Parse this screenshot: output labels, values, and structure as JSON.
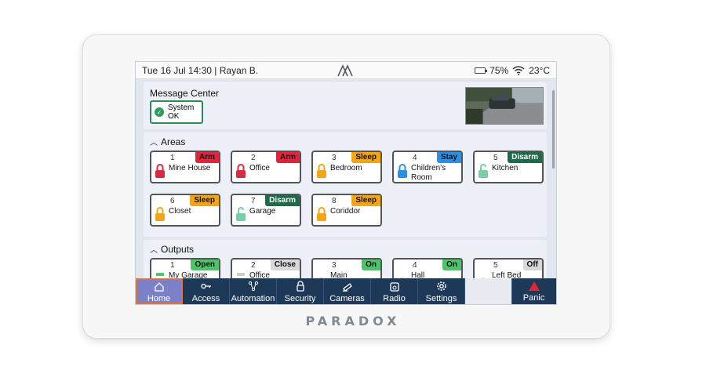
{
  "status": {
    "left": "Tue 16 Jul 14:30 | Rayan B.",
    "battery": "75%",
    "temperature": "23°C"
  },
  "message_center": {
    "title": "Message Center",
    "status_line1": "System",
    "status_line2": "OK"
  },
  "areas": {
    "title": "Areas",
    "items": [
      {
        "num": "1",
        "badge": "Arm",
        "name": "Mine House",
        "badge_color": "#e0243c",
        "lock_color": "#d92b3f"
      },
      {
        "num": "2",
        "badge": "Arm",
        "name": "Office",
        "badge_color": "#e0243c",
        "lock_color": "#d92b3f"
      },
      {
        "num": "3",
        "badge": "Sleep",
        "name": "Bedroom",
        "badge_color": "#f2a515",
        "lock_color": "#f2a515"
      },
      {
        "num": "4",
        "badge": "Stay",
        "name": "Children's Room",
        "badge_color": "#2a8fe6",
        "lock_color": "#2a8fe6"
      },
      {
        "num": "5",
        "badge": "Disarm",
        "name": "Kitchen",
        "badge_color": "#1e6b4a",
        "lock_color": "#78cfa6"
      },
      {
        "num": "6",
        "badge": "Sleep",
        "name": "Closet",
        "badge_color": "#f2a515",
        "lock_color": "#f2a515"
      },
      {
        "num": "7",
        "badge": "Disarm",
        "name": "Garage",
        "badge_color": "#1e6b4a",
        "lock_color": "#78cfa6"
      },
      {
        "num": "8",
        "badge": "Sleep",
        "name": "Coriddor",
        "badge_color": "#f2a515",
        "lock_color": "#f2a515"
      }
    ]
  },
  "outputs": {
    "title": "Outputs",
    "items": [
      {
        "num": "1",
        "badge": "Open",
        "name": "My Garage",
        "badge_color": "#4cc46a"
      },
      {
        "num": "2",
        "badge": "Close",
        "name": "Office",
        "badge_color": "#d8d8d8"
      },
      {
        "num": "3",
        "badge": "On",
        "name": "Main",
        "badge_color": "#4cc46a"
      },
      {
        "num": "4",
        "badge": "On",
        "name": "Hall",
        "badge_color": "#4cc46a"
      },
      {
        "num": "5",
        "badge": "Off",
        "name": "Left Bed",
        "badge_color": "#d8d8d8"
      }
    ]
  },
  "nav": {
    "items": [
      {
        "label": "Home",
        "icon": "home-icon"
      },
      {
        "label": "Access",
        "icon": "key-icon"
      },
      {
        "label": "Automation",
        "icon": "network-icon"
      },
      {
        "label": "Security",
        "icon": "lock-icon"
      },
      {
        "label": "Cameras",
        "icon": "camera-icon"
      },
      {
        "label": "Radio",
        "icon": "radio-icon"
      },
      {
        "label": "Settings",
        "icon": "gear-icon"
      }
    ],
    "panic_label": "Panic"
  },
  "brand": "PARADOX",
  "colors": {
    "nav_bg": "#1e3957",
    "nav_active": "#7b80c9",
    "panic": "#e0243c",
    "ok_green": "#2ca05a"
  }
}
